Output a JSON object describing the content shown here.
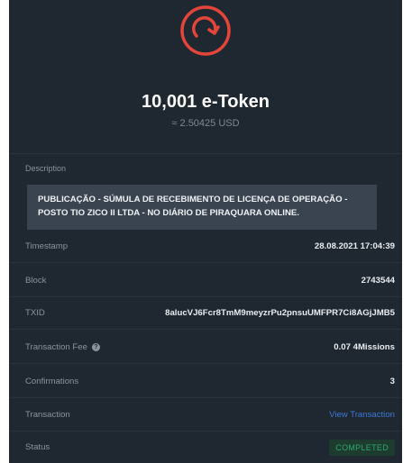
{
  "token": {
    "amount": "10,001 e-Token",
    "usd_value": "≈ 2.50425 USD",
    "logo_icon": "refresh-ring-icon",
    "accent_color": "#e4453a"
  },
  "description": {
    "label": "Description",
    "text": "PUBLICAÇÃO - SÚMULA DE RECEBIMENTO DE LICENÇA DE OPERAÇÃO - POSTO TIO ZICO II LTDA - NO DIÁRIO DE PIRAQUARA ONLINE."
  },
  "details": {
    "timestamp": {
      "label": "Timestamp",
      "value": "28.08.2021 17:04:39"
    },
    "block": {
      "label": "Block",
      "value": "2743544"
    },
    "txid": {
      "label": "TXID",
      "value": "8alucVJ6Fcr8TmM9meyzrPu2pnsuUMFPR7Ci8AGjJMB5"
    },
    "fee": {
      "label": "Transaction Fee",
      "value": "0.07 4Missions",
      "info_icon": "info-icon"
    },
    "confirmations": {
      "label": "Confirmations",
      "value": "3"
    },
    "transaction": {
      "label": "Transaction",
      "link_text": "View Transaction",
      "link_color": "#3c7bd6"
    },
    "status": {
      "label": "Status",
      "value": "COMPLETED",
      "color": "#2ea86a"
    }
  }
}
